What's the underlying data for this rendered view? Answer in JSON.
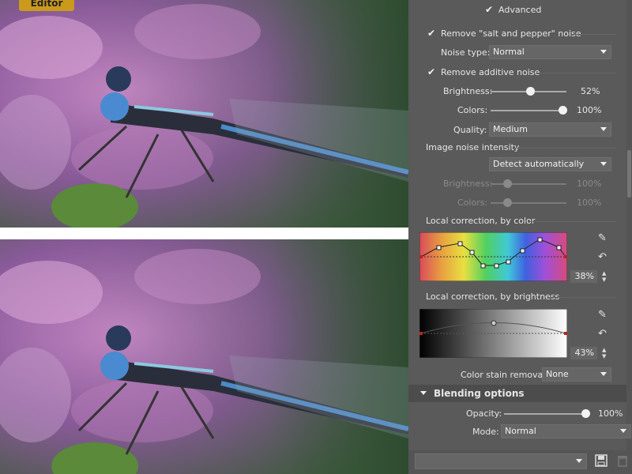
{
  "editor_badge": "Editor",
  "advanced": {
    "label": "Advanced",
    "checked": true
  },
  "remove_salt_pepper": {
    "label": "Remove \"salt and pepper\" noise",
    "checked": true
  },
  "noise_type": {
    "label": "Noise type:",
    "value": "Normal"
  },
  "remove_additive": {
    "label": "Remove additive noise",
    "checked": true
  },
  "brightness": {
    "label": "Brightness:",
    "value": "52%",
    "level": 0.52
  },
  "colors": {
    "label": "Colors:",
    "value": "100%",
    "level": 1.0
  },
  "quality": {
    "label": "Quality:",
    "value": "Medium"
  },
  "image_noise_intensity": {
    "label": "Image noise intensity",
    "value": "Detect automatically"
  },
  "brightness_disabled": {
    "label": "Brightness:",
    "value": "100%",
    "level": 0.25
  },
  "colors_disabled": {
    "label": "Colors:",
    "value": "100%",
    "level": 0.25
  },
  "local_color": {
    "label": "Local correction, by color",
    "value": "38%"
  },
  "local_brightness": {
    "label": "Local correction, by brightness",
    "value": "43%"
  },
  "color_stain": {
    "label": "Color stain removal:",
    "value": "None"
  },
  "blending": {
    "label": "Blending options"
  },
  "opacity": {
    "label": "Opacity:",
    "value": "100%",
    "level": 1.0
  },
  "mode": {
    "label": "Mode:",
    "value": "Normal"
  },
  "footer": {
    "preset_value": ""
  },
  "icons": {
    "eyedropper": "eyedropper-icon",
    "reset": "reset-arrow-icon",
    "save": "save-icon",
    "trash": "trash-icon"
  },
  "colors_accent": {
    "badge": "#c99a1c",
    "panel": "#5a5a5a"
  }
}
